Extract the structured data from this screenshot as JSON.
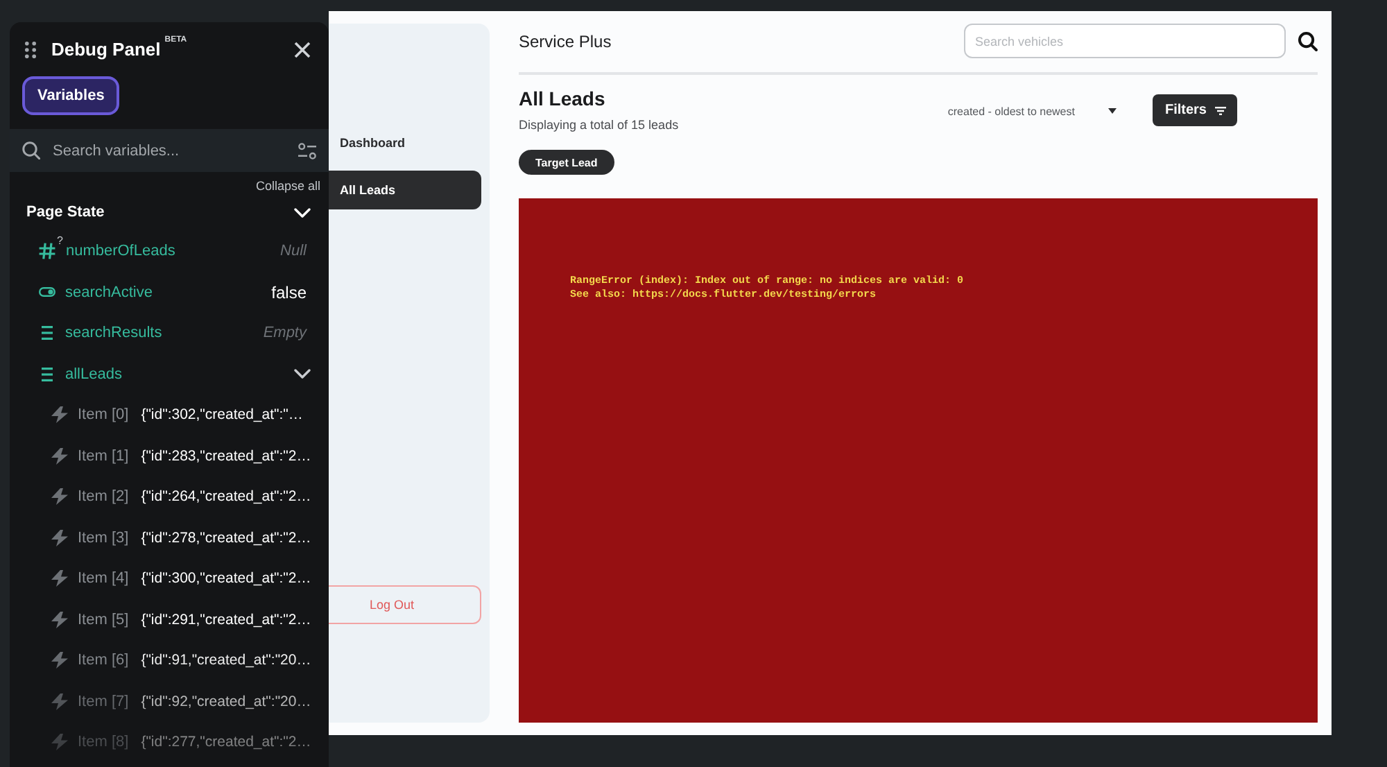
{
  "app": {
    "title": "Service Plus",
    "search": {
      "placeholder": "Search vehicles"
    },
    "sidebar": {
      "items": [
        {
          "label": "Dashboard",
          "selected": false
        },
        {
          "label": "All Leads",
          "selected": true
        }
      ],
      "logout_button": "Log Out"
    },
    "page": {
      "heading": "All Leads",
      "subtitle": "Displaying a total of 15 leads",
      "sort": {
        "value": "created - oldest to newest"
      },
      "filters_button": "Filters",
      "chips": [
        {
          "label": "Target Lead"
        }
      ],
      "error_box": {
        "lines": [
          "RangeError (index): Index out of range: no indices are valid: 0",
          "See also: https://docs.flutter.dev/testing/errors"
        ]
      }
    }
  },
  "debug_panel": {
    "title": "Debug Panel",
    "badge": "BETA",
    "tabs": [
      {
        "label": "Variables",
        "selected": true
      }
    ],
    "search": {
      "placeholder": "Search variables..."
    },
    "collapse_all": "Collapse all",
    "sections": [
      {
        "title": "Page State",
        "expanded": true,
        "variables": [
          {
            "kind": "number",
            "name": "numberOfLeads",
            "type_mark": "?",
            "value": "Null",
            "unset": true
          },
          {
            "kind": "boolean",
            "name": "searchActive",
            "value": "false",
            "unset": false
          },
          {
            "kind": "list",
            "name": "searchResults",
            "value": "Empty",
            "unset": true
          },
          {
            "kind": "list",
            "name": "allLeads",
            "expanded": true,
            "children": [
              {
                "label": "Item [0]",
                "value": "{\"id\":302,\"created_at\":\"…"
              },
              {
                "label": "Item [1]",
                "value": "{\"id\":283,\"created_at\":\"2…"
              },
              {
                "label": "Item [2]",
                "value": "{\"id\":264,\"created_at\":\"2…"
              },
              {
                "label": "Item [3]",
                "value": "{\"id\":278,\"created_at\":\"2…"
              },
              {
                "label": "Item [4]",
                "value": "{\"id\":300,\"created_at\":\"2…"
              },
              {
                "label": "Item [5]",
                "value": "{\"id\":291,\"created_at\":\"2…"
              },
              {
                "label": "Item [6]",
                "value": "{\"id\":91,\"created_at\":\"20…"
              },
              {
                "label": "Item [7]",
                "value": "{\"id\":92,\"created_at\":\"20…"
              },
              {
                "label": "Item [8]",
                "value": "{\"id\":277,\"created_at\":\"2…"
              }
            ]
          }
        ]
      }
    ]
  }
}
